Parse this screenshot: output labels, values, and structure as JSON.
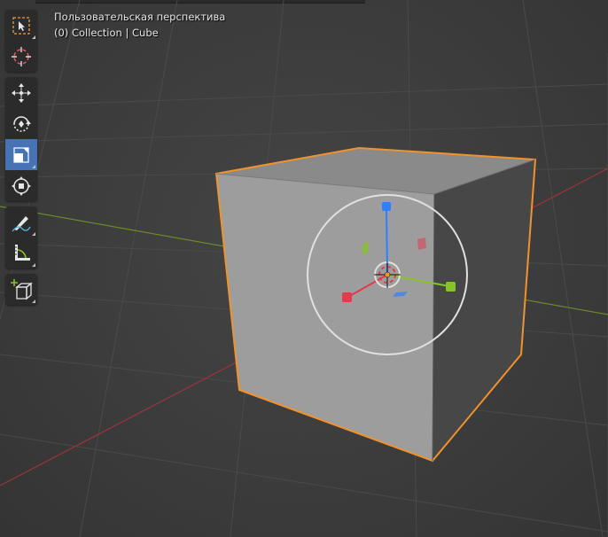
{
  "viewport": {
    "view_name": "Пользовательская перспектива",
    "collection_info": "(0) Collection | Cube"
  },
  "colors": {
    "background": "#3d3d3d",
    "grid": "#484848",
    "x_axis": "#a0353d",
    "y_axis": "#6b8e2e",
    "selection_outline": "#f2922d",
    "gizmo_x": "#e33a4f",
    "gizmo_y": "#86c42a",
    "gizmo_z": "#2f7fff",
    "active_tool": "#4772b3"
  },
  "toolbar": {
    "tools": [
      {
        "name": "select-box",
        "icon": "select-box-icon",
        "active": false
      },
      {
        "name": "cursor",
        "icon": "cursor-icon",
        "active": false
      },
      {
        "name": "move",
        "icon": "move-icon",
        "active": false
      },
      {
        "name": "rotate",
        "icon": "rotate-icon",
        "active": false
      },
      {
        "name": "scale",
        "icon": "scale-icon",
        "active": true
      },
      {
        "name": "transform",
        "icon": "transform-icon",
        "active": false
      },
      {
        "name": "annotate",
        "icon": "annotate-icon",
        "active": false
      },
      {
        "name": "measure",
        "icon": "measure-icon",
        "active": false
      },
      {
        "name": "add-cube",
        "icon": "add-cube-icon",
        "active": false
      }
    ]
  },
  "object": {
    "type": "cube",
    "selected": true
  }
}
